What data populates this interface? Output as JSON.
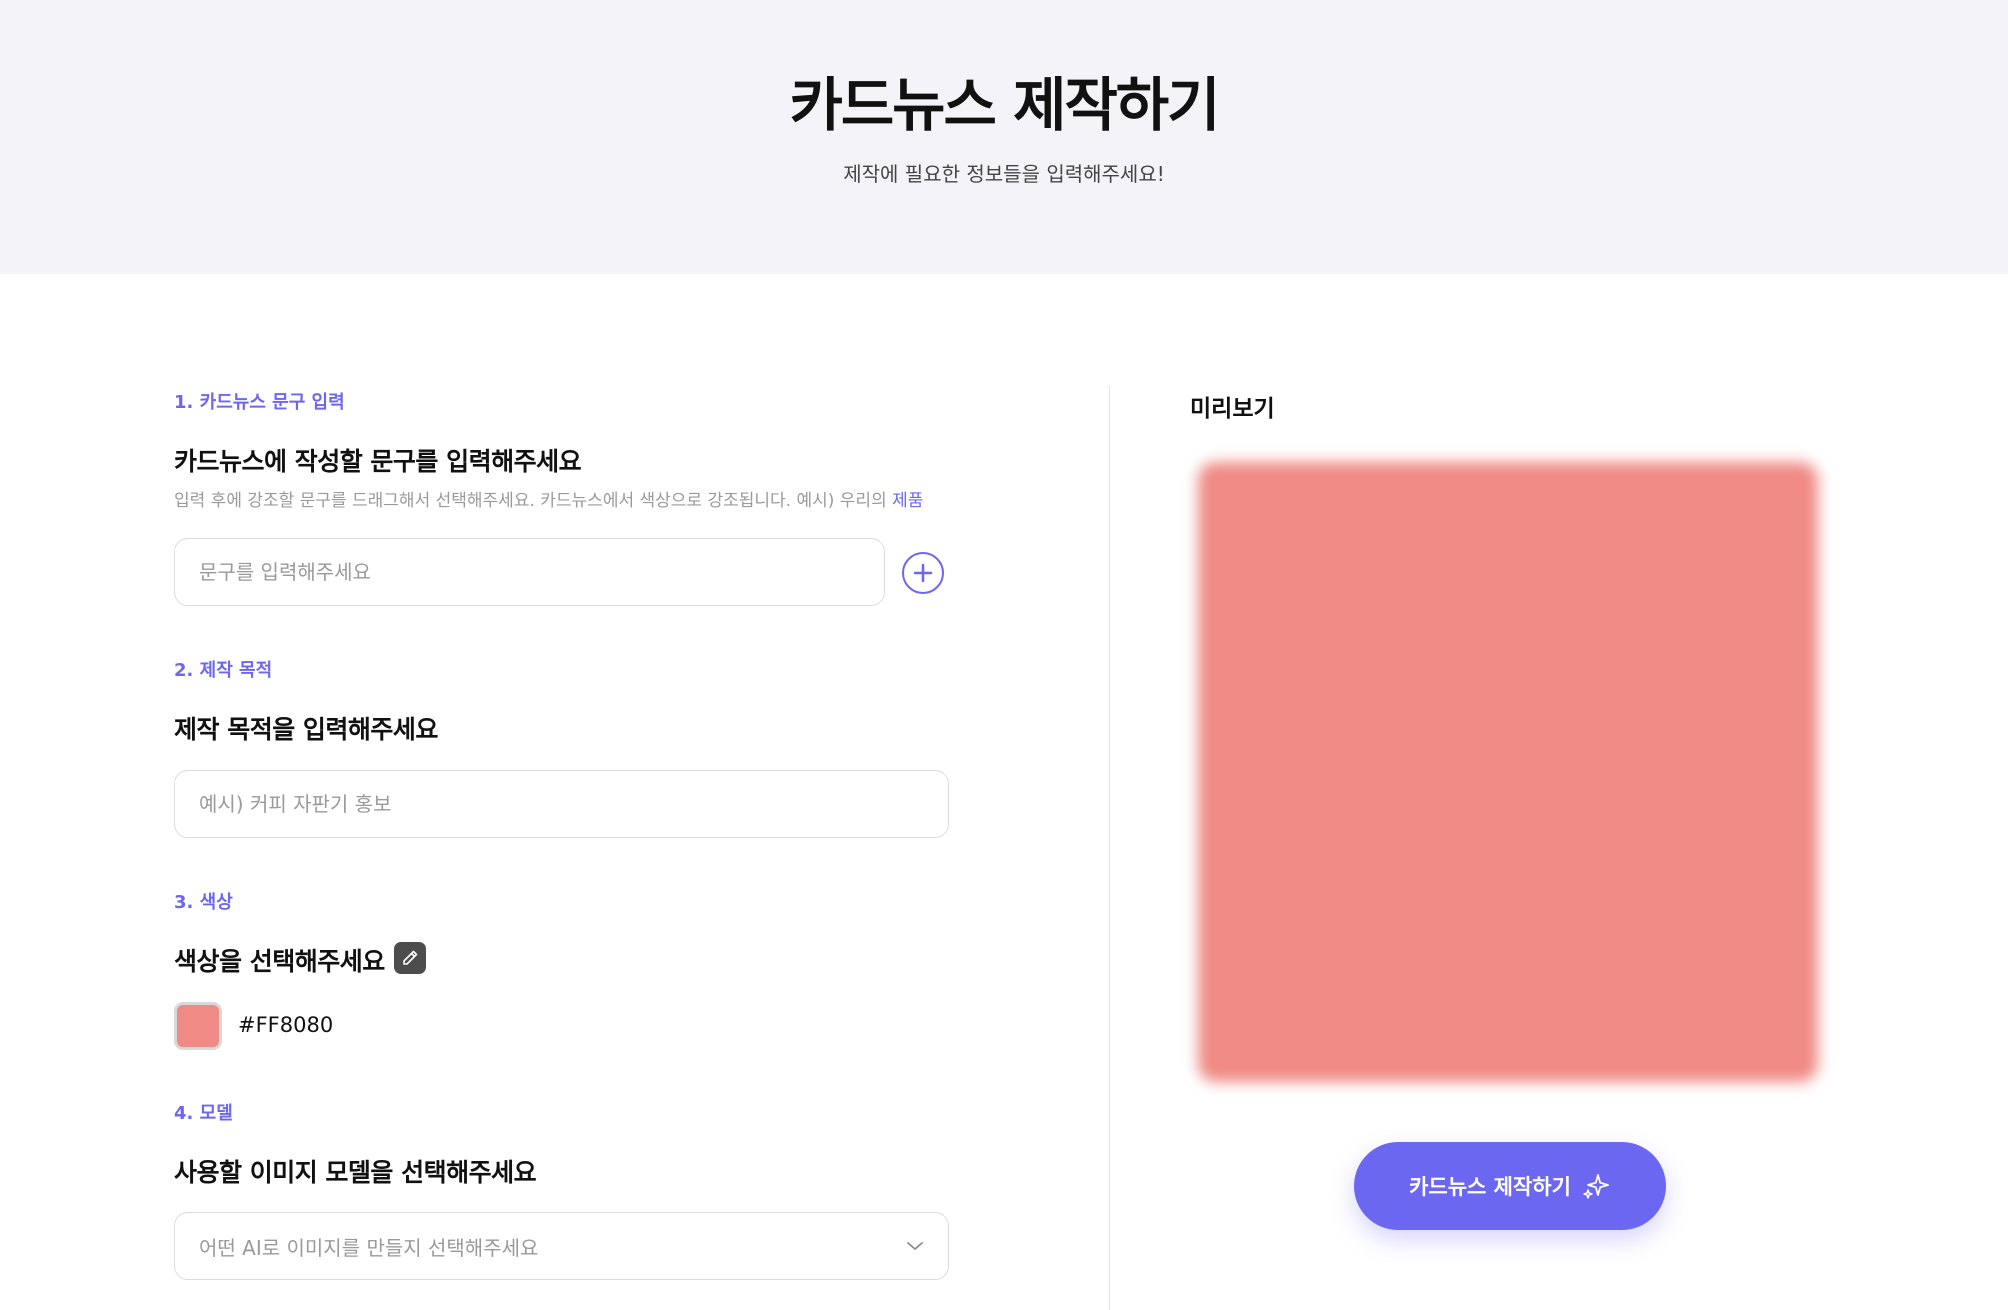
{
  "header": {
    "title": "카드뉴스 제작하기",
    "subtitle": "제작에 필요한 정보들을 입력해주세요!"
  },
  "sections": {
    "text": {
      "number_label": "1. 카드뉴스 문구 입력",
      "heading": "카드뉴스에 작성할 문구를 입력해주세요",
      "helper": "입력 후에 강조할 문구를 드래그해서 선택해주세요. 카드뉴스에서 색상으로 강조됩니다. 예시) 우리의",
      "helper_accent": "제품",
      "input_placeholder": "문구를 입력해주세요",
      "input_value": "",
      "add_icon": "plus-circle-icon"
    },
    "purpose": {
      "number_label": "2. 제작 목적",
      "heading": "제작 목적을 입력해주세요",
      "input_placeholder": "예시) 커피 자판기 홍보",
      "input_value": ""
    },
    "color": {
      "number_label": "3. 색상",
      "heading": "색상을 선택해주세요",
      "picker_icon": "eyedropper-icon",
      "value": "#FF8080",
      "swatch_color": "#ef8a84"
    },
    "model": {
      "number_label": "4. 모델",
      "heading": "사용할 이미지 모델을 선택해주세요",
      "select_placeholder": "어떤 AI로 이미지를 만들지 선택해주세요",
      "dropdown_icon": "chevron-down-icon"
    }
  },
  "preview": {
    "title": "미리보기",
    "fill_color": "#ef8a84",
    "button_label": "카드뉴스 제작하기",
    "button_icon": "sparkles-icon"
  },
  "colors": {
    "accent": "#6c67f1",
    "hero_background": "#f4f4f8"
  }
}
